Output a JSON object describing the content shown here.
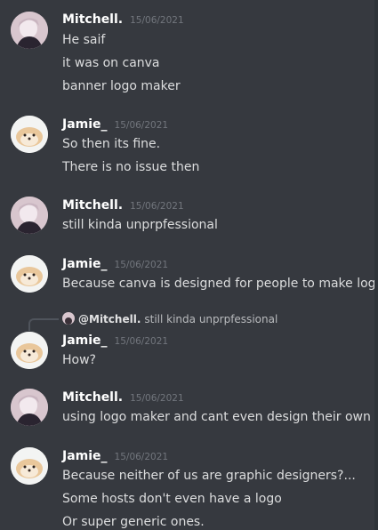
{
  "messages": [
    {
      "author": "Mitchell.",
      "timestamp": "15/06/2021",
      "lines": [
        "He saif",
        "it was on canva",
        "banner logo maker"
      ]
    },
    {
      "author": "Jamie_",
      "timestamp": "15/06/2021",
      "lines": [
        "So then its fine.",
        "There  is no issue then"
      ]
    },
    {
      "author": "Mitchell.",
      "timestamp": "15/06/2021",
      "lines": [
        "still kinda unprpfessional"
      ]
    },
    {
      "author": "Jamie_",
      "timestamp": "15/06/2021",
      "lines": [
        "Because canva is designed for people to make logos."
      ]
    },
    {
      "author": "Jamie_",
      "timestamp": "15/06/2021",
      "lines": [
        "How?"
      ],
      "reply_to": {
        "mention": "@Mitchell.",
        "text": "still kinda unprpfessional"
      }
    },
    {
      "author": "Mitchell.",
      "timestamp": "15/06/2021",
      "lines": [
        "using logo maker and cant even design their own"
      ]
    },
    {
      "author": "Jamie_",
      "timestamp": "15/06/2021",
      "lines": [
        "Because neither of us are graphic designers?...",
        "Some hosts don't even have a logo",
        "Or super generic ones."
      ]
    }
  ]
}
